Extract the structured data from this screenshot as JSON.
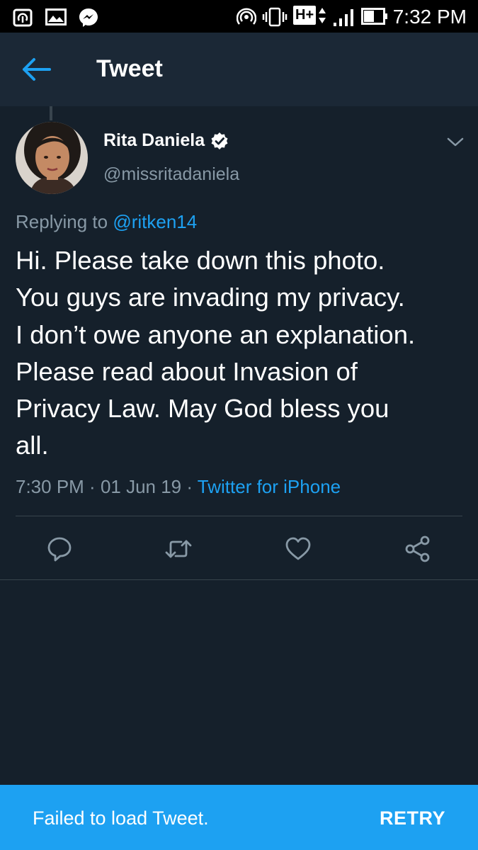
{
  "status_bar": {
    "time": "7:32 PM",
    "network": "H+",
    "left_icons": [
      "nfc-icon",
      "gallery-icon",
      "messenger-icon"
    ],
    "right_icons": [
      "hotspot-icon",
      "vibrate-icon",
      "network-type-icon",
      "signal-icon",
      "battery-icon"
    ]
  },
  "app_bar": {
    "title": "Tweet",
    "back_icon": "back-arrow-icon"
  },
  "tweet": {
    "author_name": "Rita Daniela",
    "handle": "@missritadaniela",
    "verified": true,
    "replying_prefix": "Replying to ",
    "replying_to": "@ritken14",
    "text_lines": [
      "Hi. Please take down this photo.",
      "You guys are invading my privacy.",
      "I don’t owe anyone an explanation.",
      "Please read about Invasion of",
      "Privacy Law. May God bless you",
      "all."
    ],
    "time": "7:30 PM",
    "separator": " · ",
    "date": "01 Jun 19",
    "source": "Twitter for iPhone"
  },
  "actions": [
    "reply-icon",
    "retweet-icon",
    "like-icon",
    "share-icon"
  ],
  "snackbar": {
    "message": "Failed to load Tweet.",
    "action": "RETRY"
  },
  "colors": {
    "background": "#15202b",
    "app_bar": "#1b2836",
    "accent": "#1da1f2",
    "secondary_text": "#8899a6",
    "divider": "#38444d",
    "action_icon": "#8899a6"
  }
}
